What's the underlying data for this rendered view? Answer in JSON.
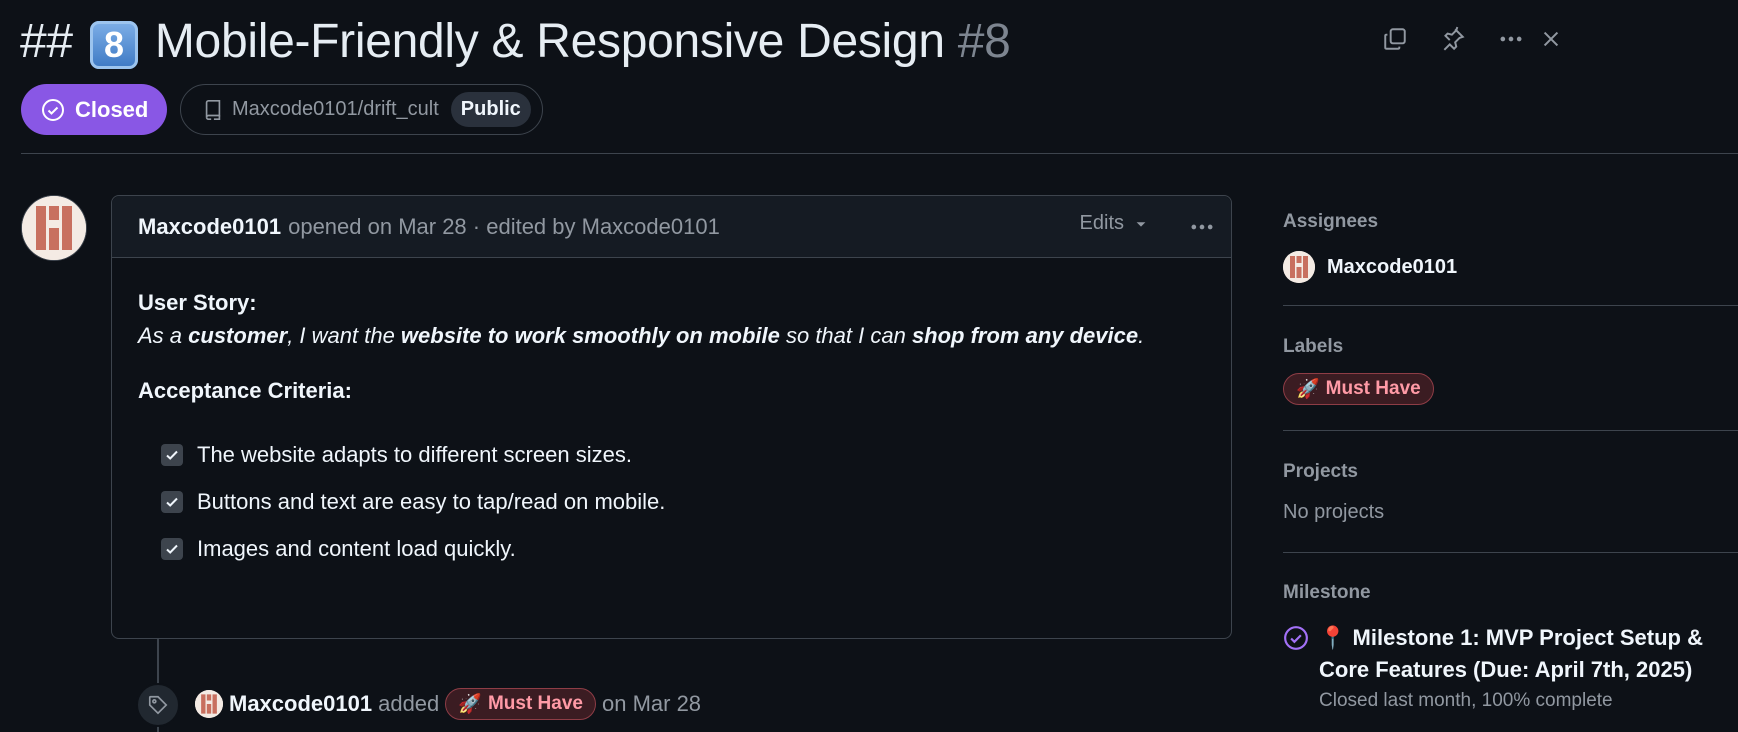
{
  "issue": {
    "title_prefix": "## ",
    "title_keycap": "8",
    "title_text": " Mobile-Friendly & Responsive Design ",
    "number": "#8",
    "state": "Closed",
    "repo": "Maxcode0101/drift_cult",
    "visibility": "Public"
  },
  "comment": {
    "author": "Maxcode0101",
    "meta": "opened on Mar 28 · edited by Maxcode0101",
    "edits_label": "Edits",
    "user_story_heading": "User Story:",
    "story": {
      "p1": "As a ",
      "b1": "customer",
      "p2": ", I want the ",
      "b2": "website to work smoothly on mobile",
      "p3": " so that I can ",
      "b3": "shop from any device",
      "p4": "."
    },
    "criteria_heading": "Acceptance Criteria:",
    "tasks": [
      {
        "text": "The website adapts to different screen sizes.",
        "checked": true
      },
      {
        "text": "Buttons and text are easy to tap/read on mobile.",
        "checked": true
      },
      {
        "text": "Images and content load quickly.",
        "checked": true
      }
    ]
  },
  "timeline": {
    "event_author": "Maxcode0101",
    "event_verb": "added",
    "event_label": "Must Have",
    "event_label_emoji": "🚀",
    "event_date": "on Mar 28"
  },
  "sidebar": {
    "assignees_title": "Assignees",
    "assignee": "Maxcode0101",
    "labels_title": "Labels",
    "label": "Must Have",
    "label_emoji": "🚀",
    "projects_title": "Projects",
    "projects_value": "No projects",
    "milestone_title": "Milestone",
    "milestone_emoji": "📍",
    "milestone_name": "Milestone 1: MVP Project Setup & Core Features (Due: April 7th, 2025)",
    "milestone_status": "Closed last month, 100% complete"
  },
  "colors": {
    "closed_badge": "#8957e5",
    "label_bg": "#3b1c22",
    "label_text": "#ff9aa6",
    "background": "#0d1117"
  },
  "icons": [
    "copy-icon",
    "pin-icon",
    "kebab-icon",
    "close-icon",
    "check-circle-icon",
    "repo-icon",
    "chevron-down-icon",
    "tag-icon",
    "checkbox-icon",
    "milestone-check-icon"
  ]
}
